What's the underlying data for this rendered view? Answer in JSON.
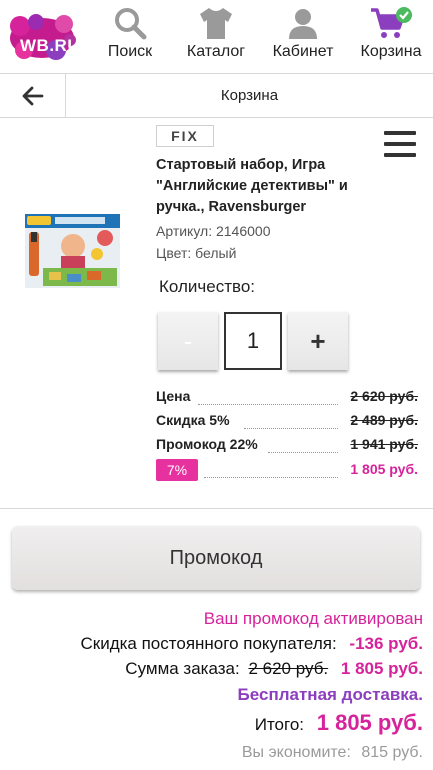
{
  "nav": {
    "logo": "WB.RU",
    "items": [
      {
        "label": "Поиск",
        "icon": "search-icon"
      },
      {
        "label": "Каталог",
        "icon": "tshirt-icon"
      },
      {
        "label": "Кабинет",
        "icon": "user-icon"
      },
      {
        "label": "Корзина",
        "icon": "cart-icon"
      }
    ]
  },
  "header": {
    "title": "Корзина",
    "back_icon": "arrow-left-icon"
  },
  "product": {
    "brand_badge": "FIX",
    "title": "Стартовый набор, Игра \"Английские детективы\" и ручка., Ravensburger",
    "article": "Артикул: 2146000",
    "color": "Цвет: белый",
    "quantity_label": "Количество:",
    "quantity": "1",
    "minus": "-",
    "plus": "+",
    "image_caption": "Стартовый набор",
    "image_brand": "tiptoi"
  },
  "prices": [
    {
      "label": "Цена",
      "value": "2 620 руб."
    },
    {
      "label": "Скидка 5%",
      "value": "2 489 руб."
    },
    {
      "label": "Промокод 22%",
      "value": "1 941 руб."
    },
    {
      "label": "7%",
      "value": "1 805 руб."
    }
  ],
  "promo_button": "Промокод",
  "summary": {
    "promo_active": "Ваш промокод активирован",
    "loyal_label": "Скидка постоянного покупателя:",
    "loyal_value": "-136 руб.",
    "order_label": "Сумма заказа:",
    "order_old": "2 620 руб.",
    "order_new": "1 805 руб.",
    "delivery": "Бесплатная доставка.",
    "total_label": "Итого:",
    "total_value": "1 805 руб.",
    "save_label": "Вы экономите:",
    "save_value": "815 руб."
  },
  "colors": {
    "accent_pink": "#d6239b",
    "brand_purple": "#8b3fbf",
    "cart_check_green": "#4cba5e"
  }
}
